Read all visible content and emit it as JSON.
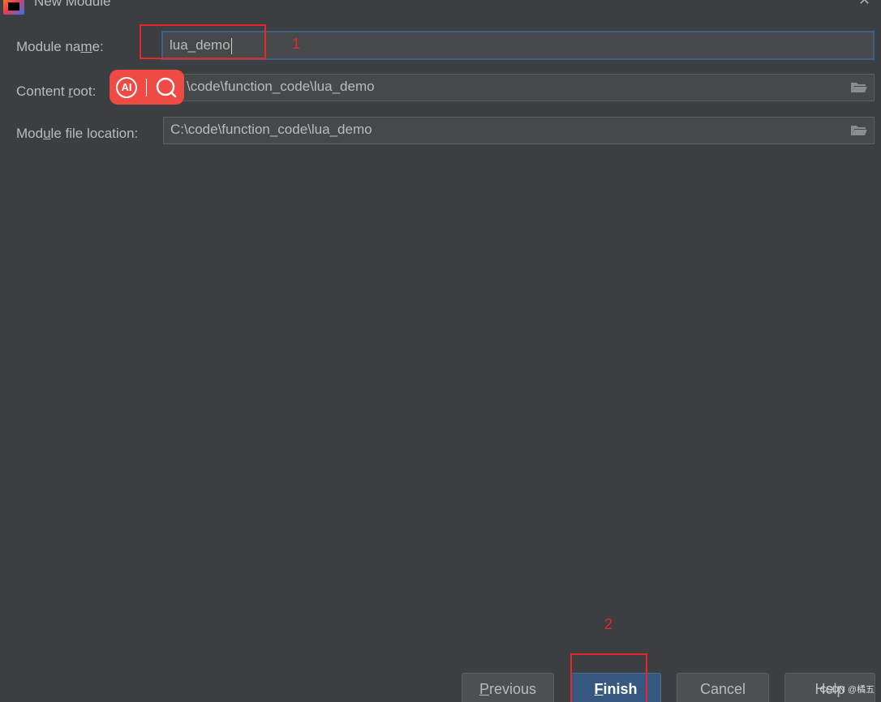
{
  "window": {
    "title": "New Module",
    "close_glyph": "✕"
  },
  "form": {
    "module_name": {
      "label_pre": "Module na",
      "label_u": "m",
      "label_post": "e:",
      "value": "lua_demo"
    },
    "content_root": {
      "label_pre": "Content ",
      "label_u": "r",
      "label_post": "oot:",
      "value": "\\code\\function_code\\lua_demo"
    },
    "module_file_location": {
      "label_pre": "Mod",
      "label_u": "u",
      "label_post": "le file location:",
      "value": "C:\\code\\function_code\\lua_demo"
    }
  },
  "overlay": {
    "ai_text": "AI",
    "search_icon": "search-icon"
  },
  "annotations": {
    "step1": "1",
    "step2": "2"
  },
  "buttons": {
    "previous": {
      "u": "P",
      "rest": "revious"
    },
    "finish": {
      "u": "F",
      "rest": "inish"
    },
    "cancel": "Cancel",
    "help": "Help"
  },
  "watermark": "CSDN @橘五",
  "colors": {
    "background": "#3c3f41",
    "field": "#45494a",
    "focus_border": "#3d6185",
    "primary_button": "#365880",
    "annotation_red": "#e8262b",
    "ai_pill": "#f04a44"
  }
}
